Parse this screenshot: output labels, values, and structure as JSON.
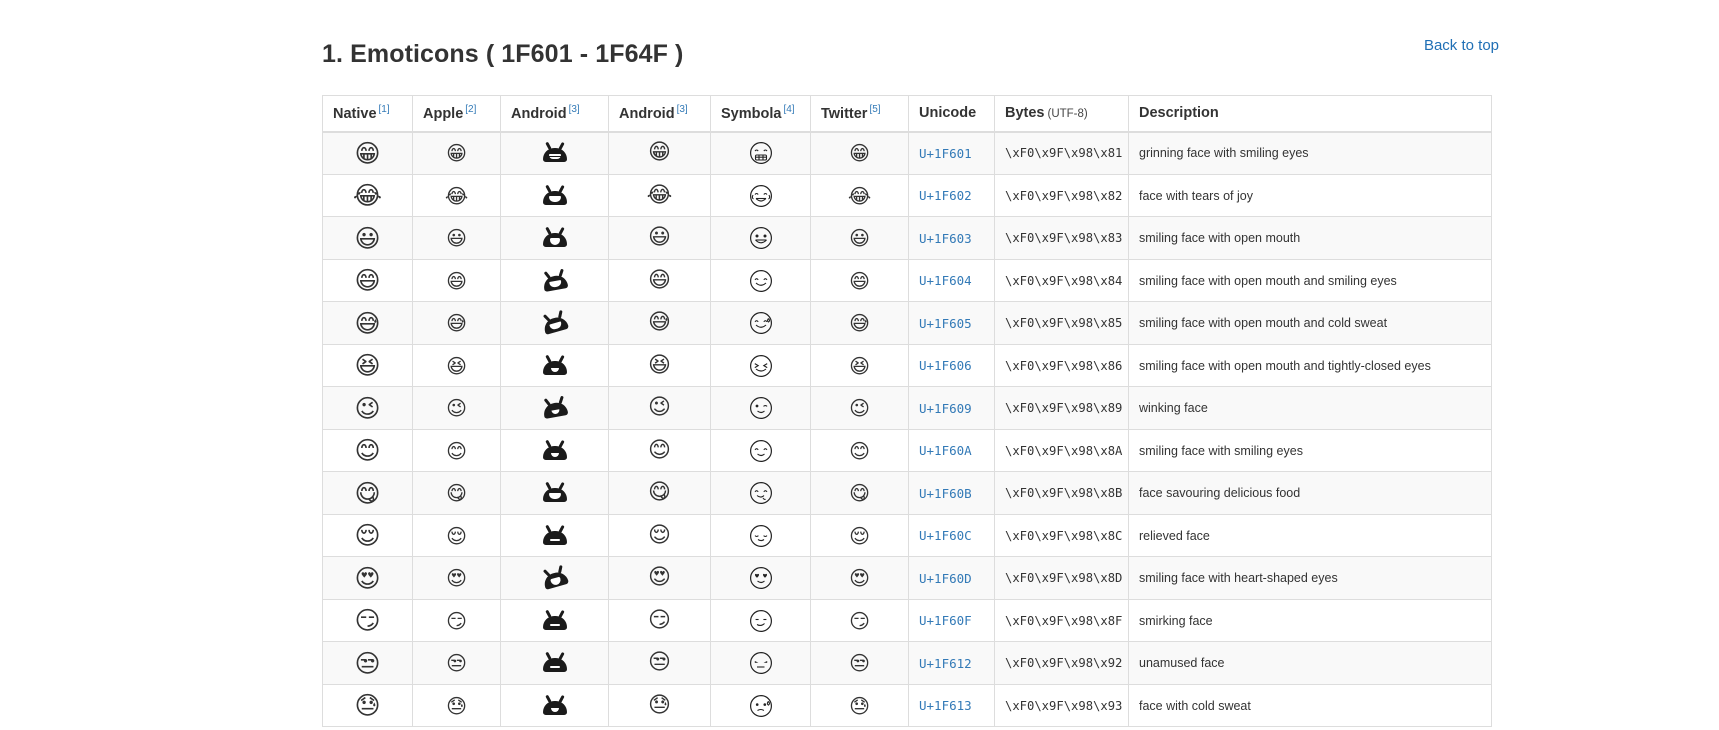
{
  "page": {
    "back_to_top": "Back to top",
    "heading": "1. Emoticons ( 1F601 - 1F64F )"
  },
  "table": {
    "columns": [
      {
        "label": "Native",
        "ref": "[1]",
        "sub": ""
      },
      {
        "label": "Apple",
        "ref": "[2]",
        "sub": ""
      },
      {
        "label": "Android",
        "ref": "[3]",
        "sub": ""
      },
      {
        "label": "Android",
        "ref": "[3]",
        "sub": ""
      },
      {
        "label": "Symbola",
        "ref": "[4]",
        "sub": ""
      },
      {
        "label": "Twitter",
        "ref": "[5]",
        "sub": ""
      },
      {
        "label": "Unicode",
        "ref": "",
        "sub": ""
      },
      {
        "label": "Bytes",
        "ref": "",
        "sub": "(UTF-8)"
      },
      {
        "label": "Description",
        "ref": "",
        "sub": ""
      }
    ],
    "rows": [
      {
        "emoji": "😁",
        "unicode": "U+1F601",
        "bytes": "\\xF0\\x9F\\x98\\x81",
        "description": "grinning face with smiling eyes"
      },
      {
        "emoji": "😂",
        "unicode": "U+1F602",
        "bytes": "\\xF0\\x9F\\x98\\x82",
        "description": "face with tears of joy"
      },
      {
        "emoji": "😃",
        "unicode": "U+1F603",
        "bytes": "\\xF0\\x9F\\x98\\x83",
        "description": "smiling face with open mouth"
      },
      {
        "emoji": "😄",
        "unicode": "U+1F604",
        "bytes": "\\xF0\\x9F\\x98\\x84",
        "description": "smiling face with open mouth and smiling eyes"
      },
      {
        "emoji": "😅",
        "unicode": "U+1F605",
        "bytes": "\\xF0\\x9F\\x98\\x85",
        "description": "smiling face with open mouth and cold sweat"
      },
      {
        "emoji": "😆",
        "unicode": "U+1F606",
        "bytes": "\\xF0\\x9F\\x98\\x86",
        "description": "smiling face with open mouth and tightly-closed eyes"
      },
      {
        "emoji": "😉",
        "unicode": "U+1F609",
        "bytes": "\\xF0\\x9F\\x98\\x89",
        "description": "winking face"
      },
      {
        "emoji": "😊",
        "unicode": "U+1F60A",
        "bytes": "\\xF0\\x9F\\x98\\x8A",
        "description": "smiling face with smiling eyes"
      },
      {
        "emoji": "😋",
        "unicode": "U+1F60B",
        "bytes": "\\xF0\\x9F\\x98\\x8B",
        "description": "face savouring delicious food"
      },
      {
        "emoji": "😌",
        "unicode": "U+1F60C",
        "bytes": "\\xF0\\x9F\\x98\\x8C",
        "description": "relieved face"
      },
      {
        "emoji": "😍",
        "unicode": "U+1F60D",
        "bytes": "\\xF0\\x9F\\x98\\x8D",
        "description": "smiling face with heart-shaped eyes"
      },
      {
        "emoji": "😏",
        "unicode": "U+1F60F",
        "bytes": "\\xF0\\x9F\\x98\\x8F",
        "description": "smirking face"
      },
      {
        "emoji": "😒",
        "unicode": "U+1F612",
        "bytes": "\\xF0\\x9F\\x98\\x92",
        "description": "unamused face"
      },
      {
        "emoji": "😓",
        "unicode": "U+1F613",
        "bytes": "\\xF0\\x9F\\x98\\x93",
        "description": "face with cold sweat"
      }
    ]
  },
  "colors": {
    "link": "#337ab7",
    "text": "#333333",
    "border": "#dddddd",
    "row_alt": "#f9f9f9",
    "emoji_yellow": "#f7c22e"
  }
}
